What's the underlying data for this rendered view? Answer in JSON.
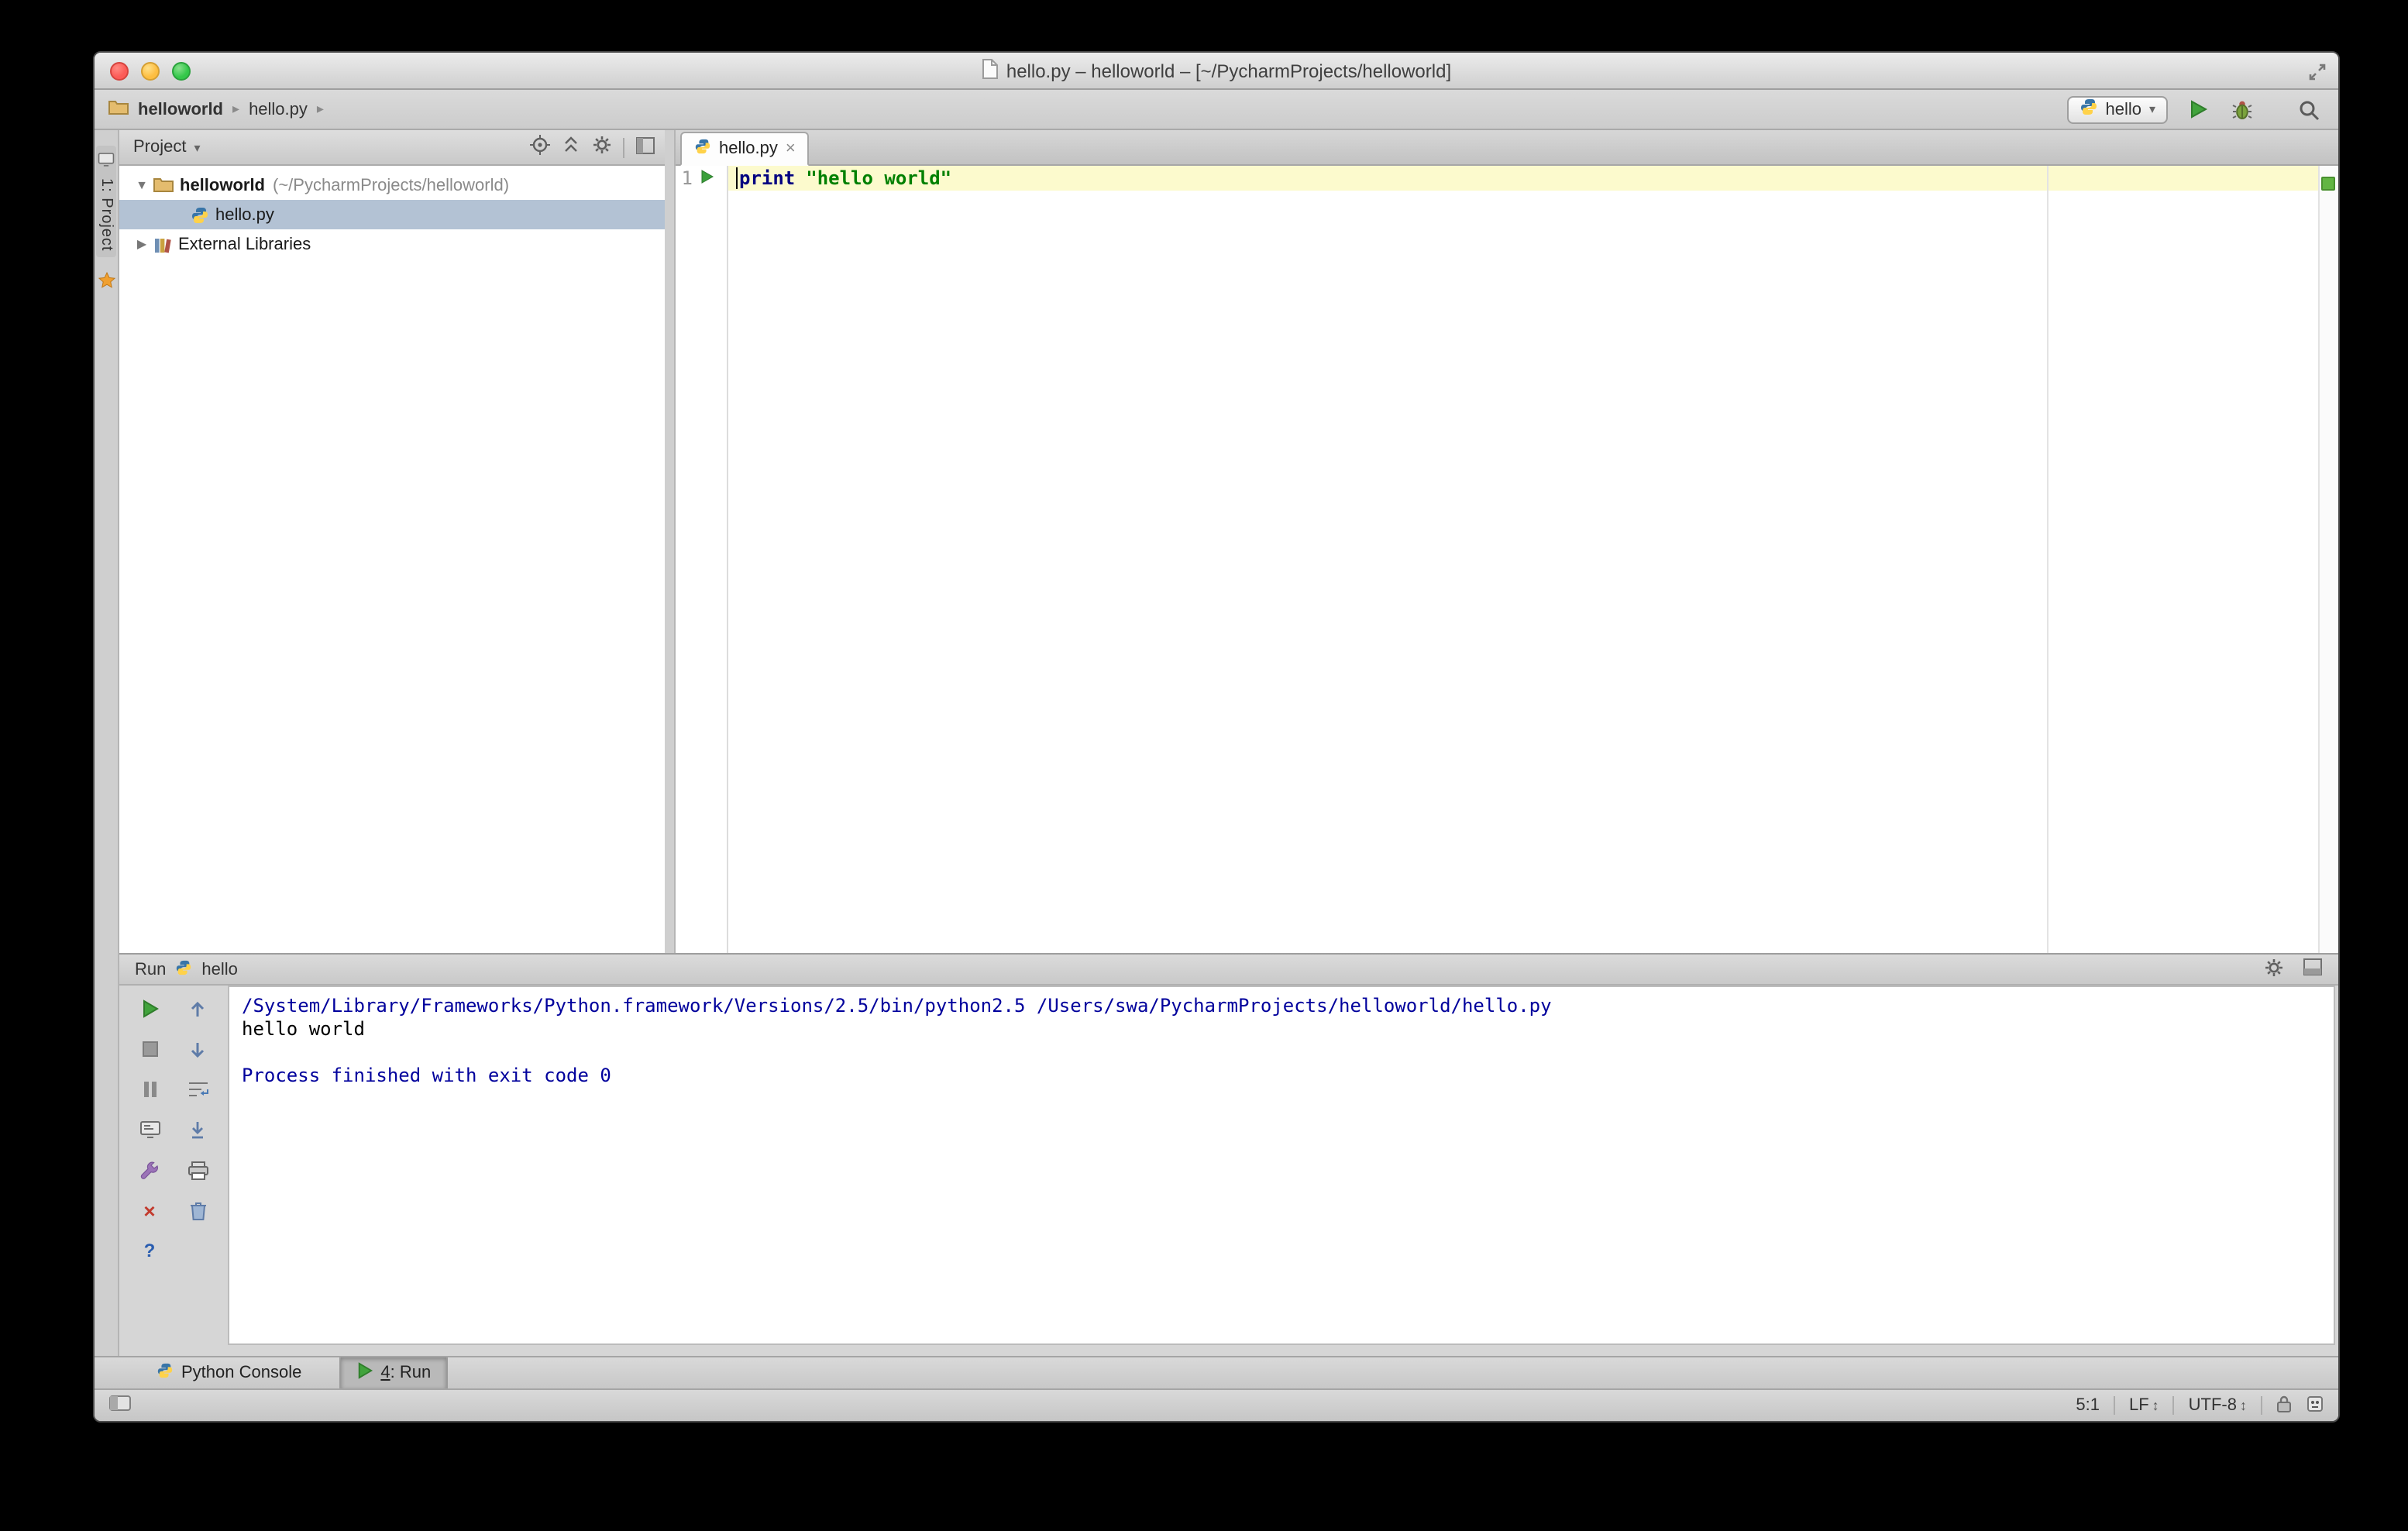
{
  "colors": {
    "keyword": "#000080",
    "string": "#008000",
    "console_system_text": "#00009c",
    "run_green": "#3da234",
    "selection_background": "#b3c2d4",
    "current_line_background": "#fcfacd"
  },
  "window": {
    "title": "hello.py – helloworld – [~/PycharmProjects/helloworld]"
  },
  "breadcrumb": {
    "items": [
      "helloworld",
      "hello.py"
    ]
  },
  "toolbar": {
    "run_config": "hello"
  },
  "tool_strip": {
    "project_tab": "1: Project"
  },
  "project": {
    "view_selector": "Project",
    "root_name": "helloworld",
    "root_path": "(~/PycharmProjects/helloworld)",
    "file_name": "hello.py",
    "external_libraries": "External Libraries"
  },
  "editor": {
    "tab_title": "hello.py",
    "line_number": "1",
    "keyword": "print",
    "string": "\"hello world\""
  },
  "run": {
    "title": "Run",
    "config": "hello",
    "console_lines": [
      "/System/Library/Frameworks/Python.framework/Versions/2.5/bin/python2.5 /Users/swa/PycharmProjects/helloworld/hello.py",
      "hello world",
      "",
      "Process finished with exit code 0"
    ]
  },
  "bottom": {
    "python_console": "Python Console",
    "run_number": "4",
    "run_label": ": Run"
  },
  "status": {
    "caret_position": "5:1",
    "line_separator": "LF",
    "encoding": "UTF-8"
  },
  "icons": {
    "breadcrumb_separator": "▸",
    "dropdown_arrow": "▾",
    "tree_expanded": "▼",
    "tree_collapsed": "▶",
    "tab_close": "×",
    "close": "×",
    "help": "?",
    "updown": "↕"
  }
}
